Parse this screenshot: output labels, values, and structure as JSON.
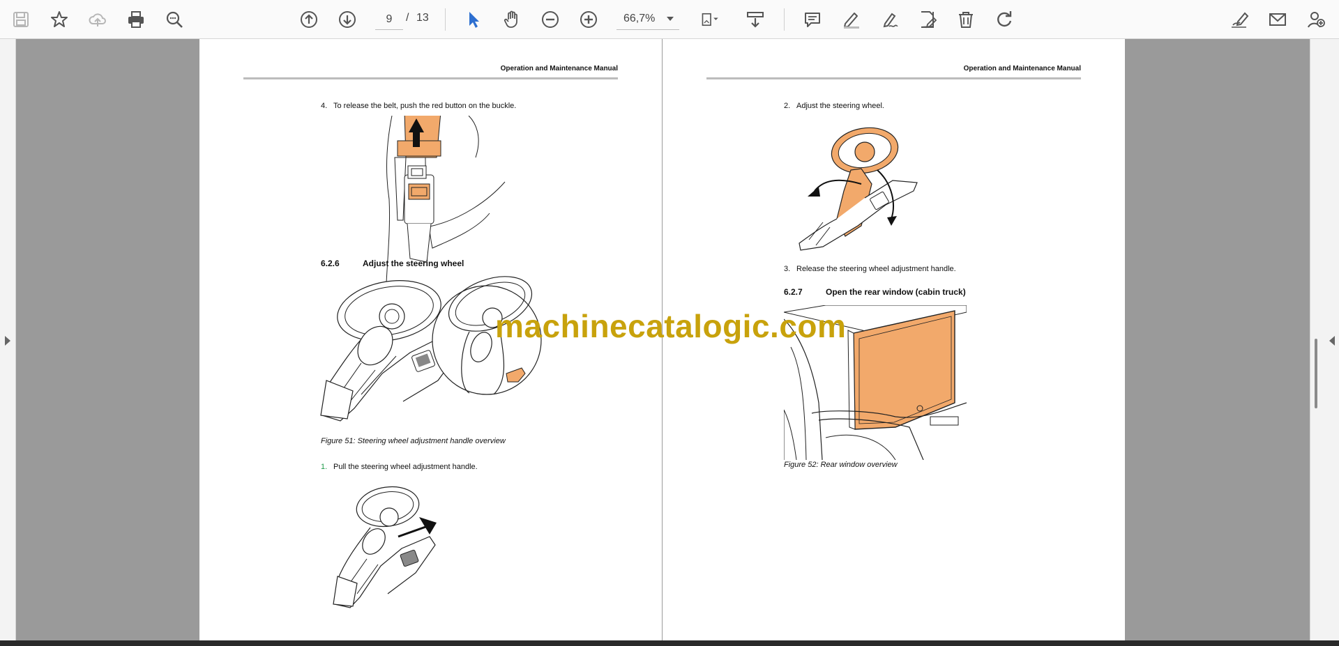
{
  "toolbar": {
    "buttons": [
      {
        "name": "save-icon",
        "enabled": false
      },
      {
        "name": "bookmark-star-icon",
        "enabled": true
      },
      {
        "name": "cloud-upload-icon",
        "enabled": false
      },
      {
        "name": "print-icon",
        "enabled": true
      },
      {
        "name": "find-zoom-icon",
        "enabled": true
      },
      {
        "name": "previous-page-icon",
        "enabled": true
      },
      {
        "name": "next-page-icon",
        "enabled": true
      },
      {
        "name": "select-cursor-icon",
        "enabled": true,
        "active": true
      },
      {
        "name": "hand-tool-icon",
        "enabled": true
      },
      {
        "name": "zoom-out-icon",
        "enabled": true
      },
      {
        "name": "zoom-in-icon",
        "enabled": true
      },
      {
        "name": "page-fit-icon",
        "enabled": true
      },
      {
        "name": "scroll-mode-icon",
        "enabled": true
      },
      {
        "name": "comment-icon",
        "enabled": true
      },
      {
        "name": "highlight-pen-icon",
        "enabled": true
      },
      {
        "name": "sign-icon",
        "enabled": true
      },
      {
        "name": "edit-doc-icon",
        "enabled": true
      },
      {
        "name": "trash-icon",
        "enabled": true
      },
      {
        "name": "redo-icon",
        "enabled": true
      },
      {
        "name": "fill-sign-icon",
        "enabled": true
      },
      {
        "name": "mail-icon",
        "enabled": true
      },
      {
        "name": "add-user-icon",
        "enabled": true
      }
    ],
    "page_number": "9",
    "page_separator": "/",
    "page_total": "13",
    "zoom": "66,7%",
    "accent": "#2d6fd0"
  },
  "left_page": {
    "header": "Operation and Maintenance Manual",
    "step4": {
      "num": "4.",
      "text": "To release the belt, push the red button on the buckle."
    },
    "section": {
      "num": "6.2.6",
      "title": "Adjust the steering wheel"
    },
    "figure51_caption": "Figure 51: Steering wheel adjustment handle overview",
    "step1": {
      "num": "1.",
      "text": "Pull the steering wheel adjustment handle."
    }
  },
  "right_page": {
    "header": "Operation and Maintenance Manual",
    "step2": {
      "num": "2.",
      "text": "Adjust the steering wheel."
    },
    "step3": {
      "num": "3.",
      "text": "Release the steering wheel adjustment handle."
    },
    "section": {
      "num": "6.2.7",
      "title": "Open the rear window (cabin truck)"
    },
    "figure52_caption": "Figure 52: Rear window overview"
  },
  "watermark": "machinecatalogic.com",
  "colors": {
    "highlight_orange": "#f2a96b",
    "watermark": "#c8a20c",
    "viewer_background": "#9a9a9a"
  }
}
